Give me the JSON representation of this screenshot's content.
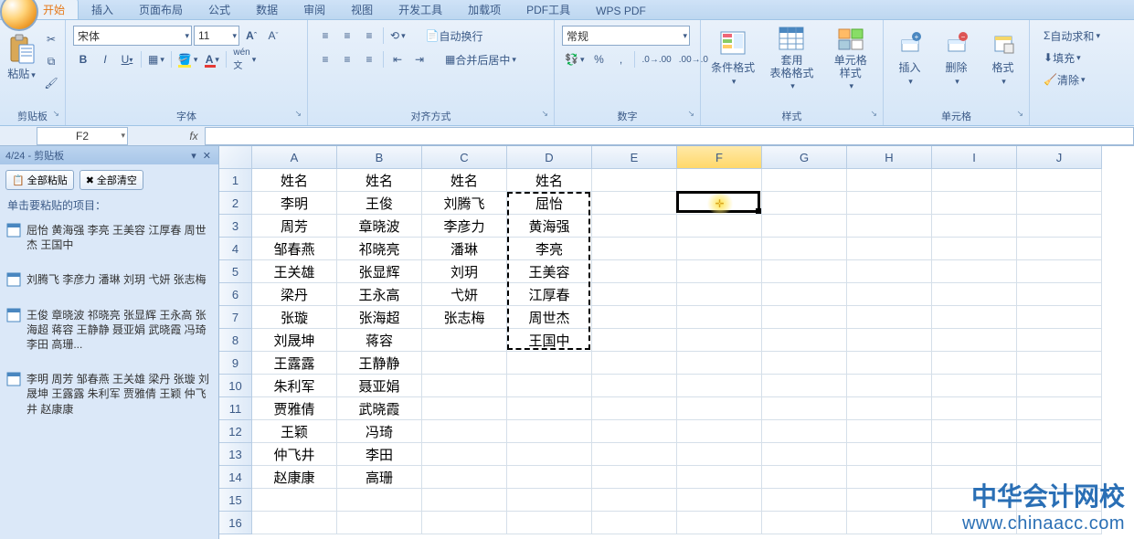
{
  "tabs": {
    "items": [
      "开始",
      "插入",
      "页面布局",
      "公式",
      "数据",
      "审阅",
      "视图",
      "开发工具",
      "加载项",
      "PDF工具",
      "WPS PDF"
    ],
    "active_index": 0
  },
  "ribbon": {
    "clipboard": {
      "paste": "粘贴",
      "title": "剪贴板"
    },
    "font": {
      "name": "宋体",
      "size": "11",
      "title": "字体"
    },
    "align": {
      "wrap": "自动换行",
      "merge": "合并后居中",
      "title": "对齐方式"
    },
    "number": {
      "format": "常规",
      "title": "数字"
    },
    "styles": {
      "cond": "条件格式",
      "table": "套用\n表格格式",
      "cell": "单元格\n样式",
      "title": "样式"
    },
    "cells": {
      "insert": "插入",
      "delete": "删除",
      "format": "格式",
      "title": "单元格"
    },
    "editing": {
      "sum": "自动求和",
      "fill": "填充",
      "clear": "清除"
    }
  },
  "formula_bar": {
    "name_box": "F2",
    "fx": "fx",
    "value": ""
  },
  "clipboard_pane": {
    "title": "4/24 - 剪贴板",
    "paste_all": "全部粘贴",
    "clear_all": "全部清空",
    "hint": "单击要粘贴的项目：",
    "items": [
      "屈怡 黄海强 李亮 王美容 江厚春 周世杰 王国中",
      "刘腾飞 李彦力 潘琳 刘玥 弋妍 张志梅",
      "王俊 章晓波 祁晓亮 张显辉 王永高 张海超 蒋容 王静静 聂亚娟 武晓霞 冯琦 李田 高珊...",
      "李明 周芳 邹春燕 王关雄 梁丹 张璇 刘晟坤 王露露 朱利军 贾雅倩 王颖 仲飞井 赵康康"
    ]
  },
  "sheet": {
    "cols": [
      "A",
      "B",
      "C",
      "D",
      "E",
      "F",
      "G",
      "H",
      "I",
      "J"
    ],
    "active_cell": "F2",
    "active_col_index": 5,
    "active_row_index": 1,
    "rows": [
      [
        "姓名",
        "姓名",
        "姓名",
        "姓名",
        "",
        "",
        "",
        "",
        "",
        ""
      ],
      [
        "李明",
        "王俊",
        "刘腾飞",
        "屈怡",
        "",
        "",
        "",
        "",
        "",
        ""
      ],
      [
        "周芳",
        "章晓波",
        "李彦力",
        "黄海强",
        "",
        "",
        "",
        "",
        "",
        ""
      ],
      [
        "邹春燕",
        "祁晓亮",
        "潘琳",
        "李亮",
        "",
        "",
        "",
        "",
        "",
        ""
      ],
      [
        "王关雄",
        "张显辉",
        "刘玥",
        "王美容",
        "",
        "",
        "",
        "",
        "",
        ""
      ],
      [
        "梁丹",
        "王永高",
        "弋妍",
        "江厚春",
        "",
        "",
        "",
        "",
        "",
        ""
      ],
      [
        "张璇",
        "张海超",
        "张志梅",
        "周世杰",
        "",
        "",
        "",
        "",
        "",
        ""
      ],
      [
        "刘晟坤",
        "蒋容",
        "",
        "王国中",
        "",
        "",
        "",
        "",
        "",
        ""
      ],
      [
        "王露露",
        "王静静",
        "",
        "",
        "",
        "",
        "",
        "",
        "",
        ""
      ],
      [
        "朱利军",
        "聂亚娟",
        "",
        "",
        "",
        "",
        "",
        "",
        "",
        ""
      ],
      [
        "贾雅倩",
        "武晓霞",
        "",
        "",
        "",
        "",
        "",
        "",
        "",
        ""
      ],
      [
        "王颖",
        "冯琦",
        "",
        "",
        "",
        "",
        "",
        "",
        "",
        ""
      ],
      [
        "仲飞井",
        "李田",
        "",
        "",
        "",
        "",
        "",
        "",
        "",
        ""
      ],
      [
        "赵康康",
        "高珊",
        "",
        "",
        "",
        "",
        "",
        "",
        "",
        ""
      ]
    ],
    "marquee": {
      "col": 3,
      "row_start": 1,
      "row_end": 7
    }
  },
  "watermark": {
    "cn": "中华会计网校",
    "en": "www.chinaacc.com"
  },
  "chart_data": {
    "type": "table",
    "columns": [
      "姓名",
      "姓名",
      "姓名",
      "姓名"
    ],
    "rows": [
      [
        "李明",
        "王俊",
        "刘腾飞",
        "屈怡"
      ],
      [
        "周芳",
        "章晓波",
        "李彦力",
        "黄海强"
      ],
      [
        "邹春燕",
        "祁晓亮",
        "潘琳",
        "李亮"
      ],
      [
        "王关雄",
        "张显辉",
        "刘玥",
        "王美容"
      ],
      [
        "梁丹",
        "王永高",
        "弋妍",
        "江厚春"
      ],
      [
        "张璇",
        "张海超",
        "张志梅",
        "周世杰"
      ],
      [
        "刘晟坤",
        "蒋容",
        "",
        "王国中"
      ],
      [
        "王露露",
        "王静静",
        "",
        ""
      ],
      [
        "朱利军",
        "聂亚娟",
        "",
        ""
      ],
      [
        "贾雅倩",
        "武晓霞",
        "",
        ""
      ],
      [
        "王颖",
        "冯琦",
        "",
        ""
      ],
      [
        "仲飞井",
        "李田",
        "",
        ""
      ],
      [
        "赵康康",
        "高珊",
        "",
        ""
      ]
    ]
  }
}
